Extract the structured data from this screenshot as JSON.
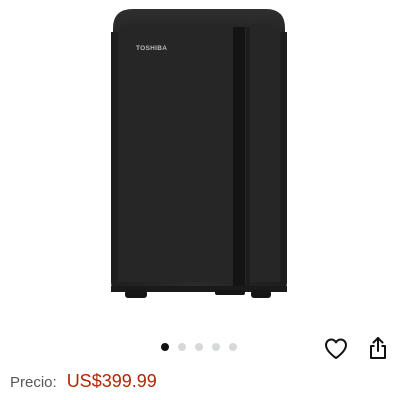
{
  "product": {
    "brand": "TOSHIBA",
    "image_count": 5,
    "current_image": 1
  },
  "actions": {
    "favorite_icon": "heart-icon",
    "share_icon": "share-icon"
  },
  "price": {
    "label": "Precio:",
    "value": "US$399.99"
  },
  "colors": {
    "price": "#b12704",
    "dot_active": "#111111",
    "dot_inactive": "#d5d9d9"
  }
}
